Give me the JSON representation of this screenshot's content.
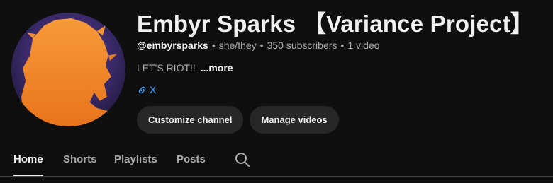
{
  "channel": {
    "name": "Embyr Sparks 【Variance Project】",
    "handle": "@embyrsparks",
    "pronouns": "she/they",
    "subscribers": "350 subscribers",
    "videos": "1 video",
    "separator": "•",
    "description": "LET'S RIOT!!",
    "more_label": "...more",
    "link_label": "X"
  },
  "actions": {
    "customize_label": "Customize channel",
    "manage_label": "Manage videos"
  },
  "tabs": [
    {
      "label": "Home",
      "active": true
    },
    {
      "label": "Shorts"
    },
    {
      "label": "Playlists"
    },
    {
      "label": "Posts"
    }
  ],
  "icons": {
    "link": "link-icon",
    "search": "search-icon"
  },
  "colors": {
    "background": "#0f0f0f",
    "link": "#3ea6ff",
    "avatar_silhouette": "#f28a2b",
    "avatar_bg": "#3a2a6a"
  }
}
